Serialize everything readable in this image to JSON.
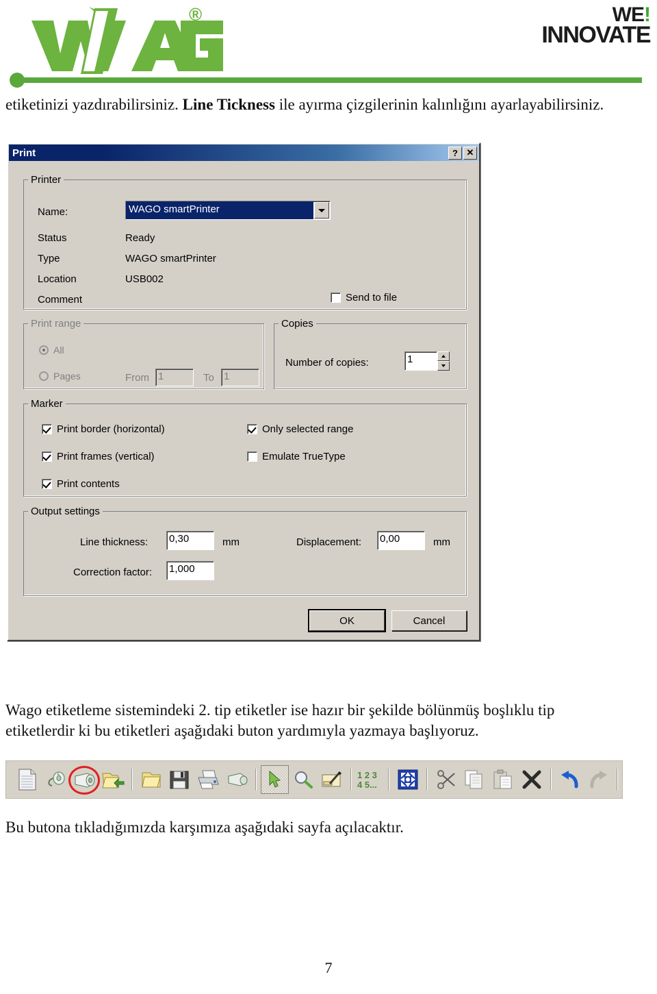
{
  "header": {
    "brand": "WAGO",
    "brand_mark": "®",
    "slogan_line1": "WE",
    "slogan_line2": "INNOVATE",
    "slogan_bang": "!",
    "brand_color": "#6cb33f",
    "rule_color": "#5aa83c"
  },
  "document": {
    "intro_before": "etiketinizi yazdırabilirsiniz. ",
    "intro_bold": "Line Tickness",
    "intro_after": " ile ayırma çizgilerinin kalınlığını ayarlayabilirsiniz.",
    "middle_paragraph": "Wago etiketleme sistemindeki 2. tip etiketler ise hazır bir şekilde bölünmüş boşlıklu tip etiketlerdir ki bu etiketleri aşağıdaki buton yardımıyla yazmaya başlıyoruz.",
    "bottom_paragraph": "Bu butona tıkladığımızda karşımıza aşağıdaki sayfa açılacaktır.",
    "page_number": "7"
  },
  "dialog": {
    "title": "Print",
    "titlebar_buttons": [
      {
        "name": "help-button",
        "glyph": "?"
      },
      {
        "name": "close-button",
        "glyph": "✕"
      }
    ],
    "printer_group": {
      "legend": "Printer",
      "name_label": "Name:",
      "name_value": "WAGO smartPrinter",
      "status_label": "Status",
      "status_value": "Ready",
      "type_label": "Type",
      "type_value": "WAGO smartPrinter",
      "location_label": "Location",
      "location_value": "USB002",
      "comment_label": "Comment",
      "comment_value": "",
      "send_to_file_label": "Send to file",
      "send_to_file_checked": false
    },
    "print_range_group": {
      "legend": "Print range",
      "disabled": true,
      "all_label": "All",
      "all_selected": true,
      "pages_label": "Pages",
      "pages_selected": false,
      "from_label": "From",
      "from_value": "1",
      "to_label": "To",
      "to_value": "1"
    },
    "copies_group": {
      "legend": "Copies",
      "number_label": "Number of copies:",
      "number_value": "1"
    },
    "marker_group": {
      "legend": "Marker",
      "checkboxes": [
        {
          "label": "Print border (horizontal)",
          "checked": true
        },
        {
          "label": "Print frames (vertical)",
          "checked": true
        },
        {
          "label": "Print contents",
          "checked": true
        },
        {
          "label": "Only selected range",
          "checked": true
        },
        {
          "label": "Emulate TrueType",
          "checked": false
        }
      ]
    },
    "output_group": {
      "legend": "Output settings",
      "line_thickness_label": "Line thickness:",
      "line_thickness_value": "0,30",
      "line_thickness_unit": "mm",
      "displacement_label": "Displacement:",
      "displacement_value": "0,00",
      "displacement_unit": "mm",
      "correction_label": "Correction factor:",
      "correction_value": "1,000"
    },
    "ok_label": "OK",
    "cancel_label": "Cancel"
  },
  "toolbar": {
    "annotation_color": "#e02020",
    "annotated_item_index": 2,
    "items": [
      {
        "icon": "new-document-icon"
      },
      {
        "icon": "label-roll-small-icon"
      },
      {
        "icon": "label-roll-icon"
      },
      {
        "icon": "open-folder-import-icon"
      },
      {
        "sep": true
      },
      {
        "icon": "open-folder-icon"
      },
      {
        "icon": "save-floppy-icon"
      },
      {
        "icon": "print-icon"
      },
      {
        "icon": "print-label-icon"
      },
      {
        "sep": true
      },
      {
        "icon": "select-arrow-icon"
      },
      {
        "icon": "zoom-icon"
      },
      {
        "icon": "edit-text-icon"
      },
      {
        "sep": true
      },
      {
        "icon": "numbering-icon"
      },
      {
        "sep": true
      },
      {
        "icon": "move-all-icon"
      },
      {
        "sep": true
      },
      {
        "icon": "cut-scissors-icon"
      },
      {
        "icon": "copy-icon"
      },
      {
        "icon": "paste-icon"
      },
      {
        "icon": "delete-x-icon"
      },
      {
        "sep": true
      },
      {
        "icon": "undo-icon"
      },
      {
        "icon": "redo-icon"
      },
      {
        "sep": true
      }
    ]
  }
}
